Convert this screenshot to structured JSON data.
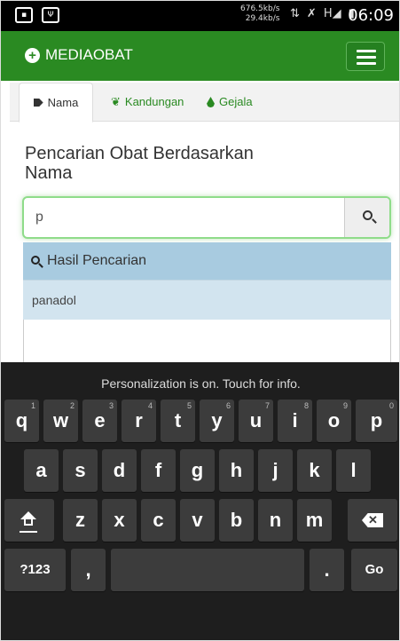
{
  "status_bar": {
    "left_icons": [
      "message-icon",
      "usb-icon"
    ],
    "speed_up": "676.5kb/s",
    "speed_down": "29.4kb/s",
    "signal_label": "H",
    "time": "06:09"
  },
  "navbar": {
    "brand": "MEDIAOBAT",
    "brand_icon": "plus-circle-icon",
    "menu_icon": "hamburger-icon",
    "color": "#2a8a22"
  },
  "tabs": [
    {
      "label": "Nama",
      "icon": "tag-icon",
      "active": true
    },
    {
      "label": "Kandungan",
      "icon": "leaf-icon",
      "active": false
    },
    {
      "label": "Gejala",
      "icon": "drop-icon",
      "active": false
    }
  ],
  "heading": "Pencarian Obat Berdasarkan Nama",
  "search": {
    "value": "p",
    "button_icon": "search-icon"
  },
  "results": {
    "header": "Hasil Pencarian",
    "items": [
      "panadol"
    ],
    "header_color": "#a8cbe0"
  },
  "keyboard": {
    "hint": "Personalization is on. Touch for info.",
    "row1": [
      {
        "k": "q",
        "n": "1"
      },
      {
        "k": "w",
        "n": "2"
      },
      {
        "k": "e",
        "n": "3"
      },
      {
        "k": "r",
        "n": "4"
      },
      {
        "k": "t",
        "n": "5"
      },
      {
        "k": "y",
        "n": "6"
      },
      {
        "k": "u",
        "n": "7"
      },
      {
        "k": "i",
        "n": "8"
      },
      {
        "k": "o",
        "n": "9"
      },
      {
        "k": "p",
        "n": "0"
      }
    ],
    "row2": [
      "a",
      "s",
      "d",
      "f",
      "g",
      "h",
      "j",
      "k",
      "l"
    ],
    "row3": [
      "z",
      "x",
      "c",
      "v",
      "b",
      "n",
      "m"
    ],
    "symbols_key": "?123",
    "comma_key": ",",
    "period_key": ".",
    "go_key": "Go"
  }
}
